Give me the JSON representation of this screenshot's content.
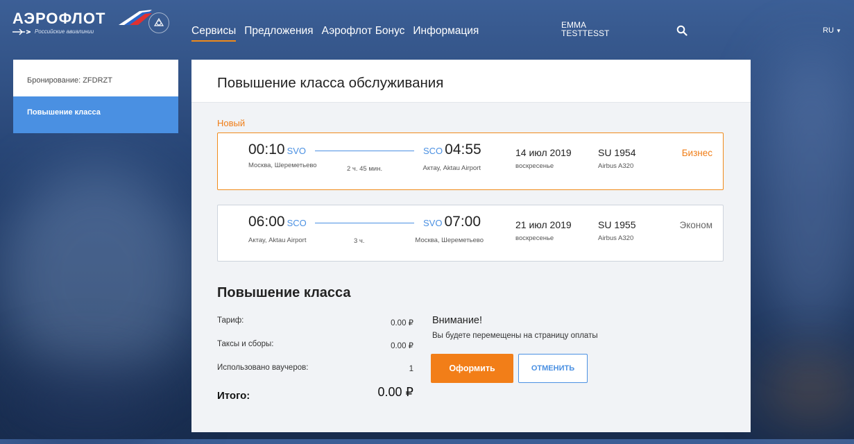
{
  "header": {
    "logo_text": "АЭРОФЛОТ",
    "logo_subtitle": "Российские авиалинии",
    "nav": [
      "Сервисы",
      "Предложения",
      "Аэрофлот Бонус",
      "Информация"
    ],
    "user_first": "EMMA",
    "user_last": "TESTTESST",
    "language": "RU"
  },
  "sidebar": {
    "items": [
      {
        "label": "Бронирование: ZFDRZT"
      },
      {
        "label": "Повышение класса"
      }
    ]
  },
  "main": {
    "title": "Повышение класса обслуживания",
    "status": "Новый",
    "segments": [
      {
        "dep_time": "00:10",
        "dep_code": "SVO",
        "dep_city": "Москва, Шереметьево",
        "duration": "2 ч. 45 мин.",
        "arr_time": "04:55",
        "arr_code": "SCO",
        "arr_city": "Актау, Aktau Airport",
        "date": "14 июл 2019",
        "weekday": "воскресенье",
        "flight": "SU 1954",
        "aircraft": "Airbus A320",
        "class": "Бизнес"
      },
      {
        "dep_time": "06:00",
        "dep_code": "SCO",
        "dep_city": "Актау, Aktau Airport",
        "duration": "3 ч.",
        "arr_time": "07:00",
        "arr_code": "SVO",
        "arr_city": "Москва, Шереметьево",
        "date": "21 июл 2019",
        "weekday": "воскресенье",
        "flight": "SU 1955",
        "aircraft": "Airbus A320",
        "class": "Эконом"
      }
    ],
    "upgrade": {
      "title": "Повышение класса",
      "fare_label": "Тариф:",
      "fare_value": "0.00 ₽",
      "taxes_label": "Таксы и сборы:",
      "taxes_value": "0.00 ₽",
      "vouchers_label": "Использовано ваучеров:",
      "vouchers_value": "1",
      "total_label": "Итого:",
      "total_value": "0.00 ₽",
      "attention_title": "Внимание!",
      "attention_text": "Вы будете перемещены на страницу оплаты",
      "submit_label": "Оформить",
      "cancel_label": "ОТМЕНИТЬ"
    }
  },
  "colors": {
    "accent_orange": "#f27e18",
    "accent_blue": "#4a90e2"
  }
}
